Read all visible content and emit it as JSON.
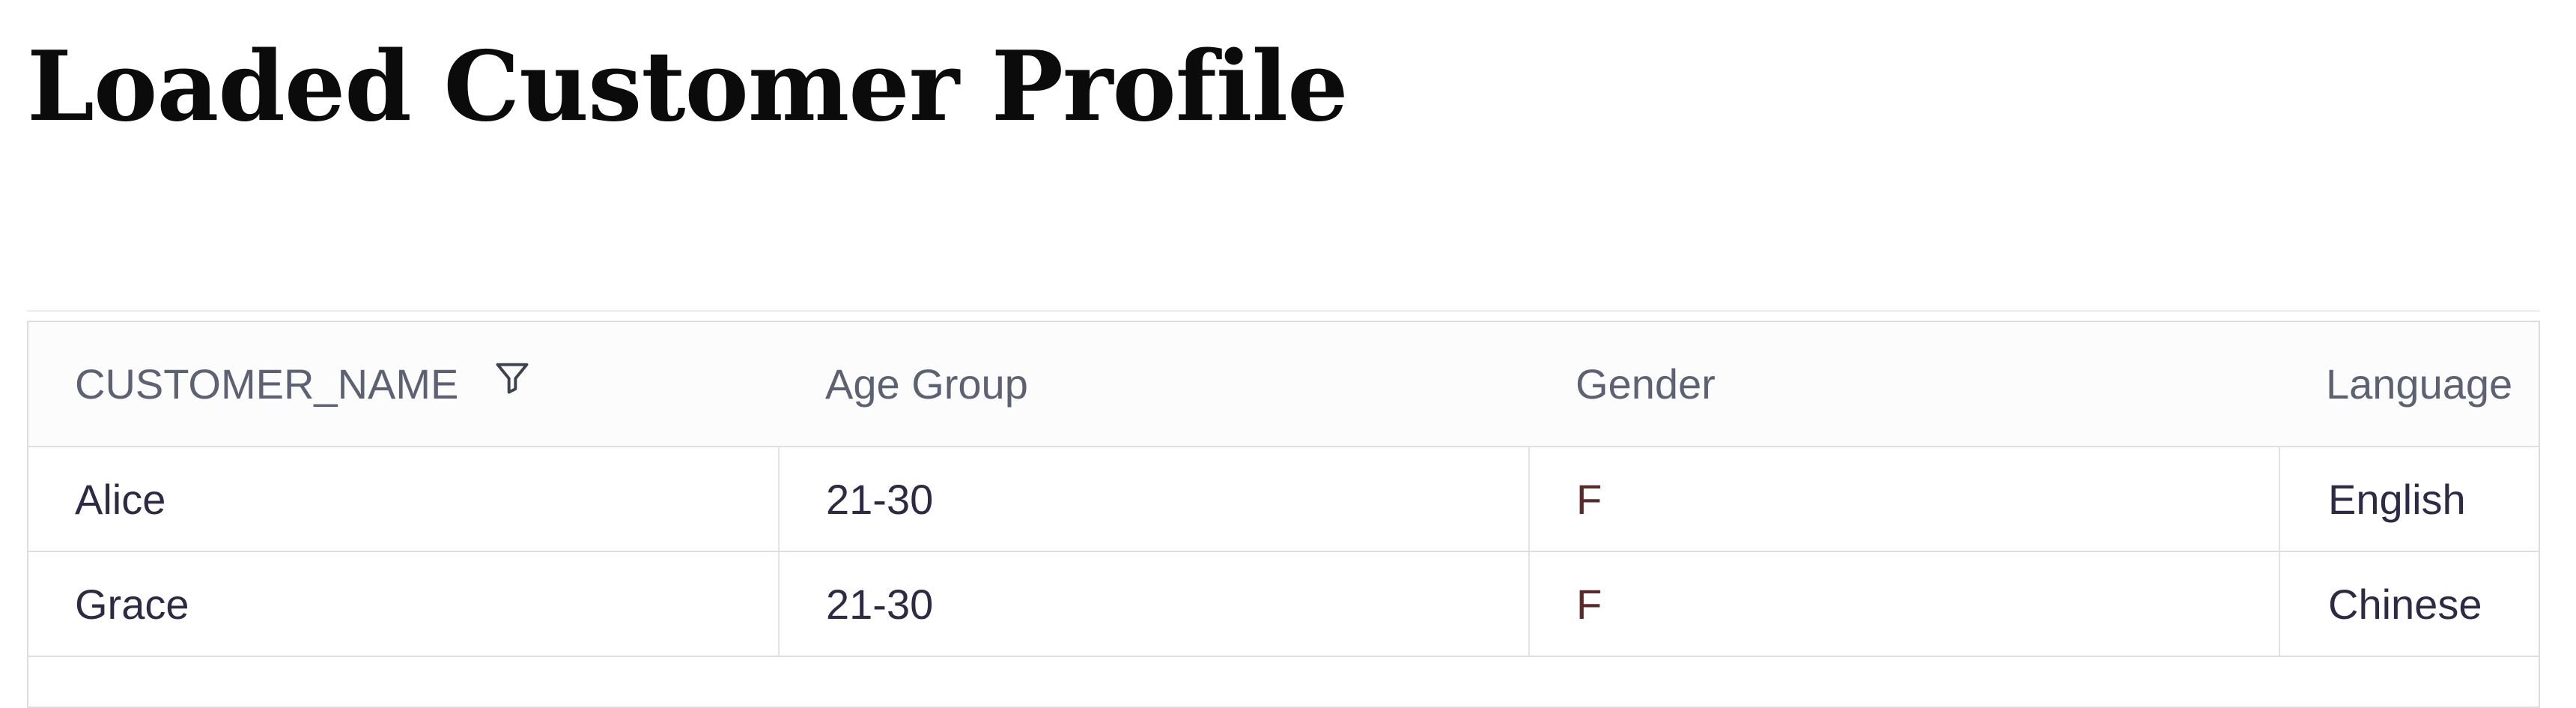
{
  "page": {
    "title": "Loaded Customer Profile"
  },
  "table": {
    "columns": [
      {
        "label": "CUSTOMER_NAME",
        "filter": true
      },
      {
        "label": "Age Group"
      },
      {
        "label": "Gender"
      },
      {
        "label": "Language"
      }
    ],
    "rows": [
      {
        "customer_name": "Alice",
        "age_group": "21-30",
        "gender": "F",
        "language": "English"
      },
      {
        "customer_name": "Grace",
        "age_group": "21-30",
        "gender": "F",
        "language": "Chinese"
      }
    ]
  },
  "icons": {
    "filter": "filter-icon"
  },
  "colors": {
    "header_text": "#5c6273",
    "cell_text": "#2c2a45",
    "border": "#dddddd",
    "header_bg": "#fcfcfc"
  }
}
